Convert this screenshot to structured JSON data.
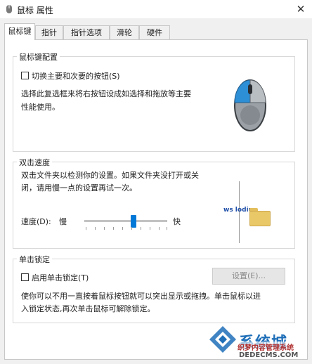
{
  "window": {
    "title": "鼠标 属性",
    "close_glyph": "✕"
  },
  "tabs": [
    {
      "label": "鼠标键",
      "active": true
    },
    {
      "label": "指针",
      "active": false
    },
    {
      "label": "指针选项",
      "active": false
    },
    {
      "label": "滑轮",
      "active": false
    },
    {
      "label": "硬件",
      "active": false
    }
  ],
  "button_config": {
    "legend": "鼠标键配置",
    "switch_label": "切换主要和次要的按钮(S)",
    "switch_checked": false,
    "description_line1": "选择此复选框来将右按钮设成如选择和拖放等主要",
    "description_line2": "性能使用。",
    "image_icon": "mouse-icon"
  },
  "double_click": {
    "legend": "双击速度",
    "description_line1": "双击文件夹以检测你的设置。如果文件夹没打开或关",
    "description_line2": "闭，请用慢一点的设置再试一次。",
    "speed_label": "速度(D):",
    "slow_label": "慢",
    "fast_label": "快",
    "speed_value_fraction": 0.6,
    "test_folder_icon": "folder-icon",
    "test_overlay_text": "ws lodiu"
  },
  "click_lock": {
    "legend": "单击锁定",
    "enable_label": "启用单击锁定(T)",
    "enable_checked": false,
    "settings_button": "设置(E)...",
    "description_line1": "使你可以不用一直按着鼠标按钮就可以突出显示或拖拽。单击鼠标以进",
    "description_line2": "入锁定状态,再次单击鼠标可解除锁定。"
  },
  "watermark": {
    "main": "系统城",
    "sub": "织梦内容管理系统",
    "url": "DEDECMS.COM"
  },
  "colors": {
    "accent": "#0078d7",
    "mouse_blue": "#2d8fd6",
    "watermark_blue": "#1f6fb8"
  }
}
